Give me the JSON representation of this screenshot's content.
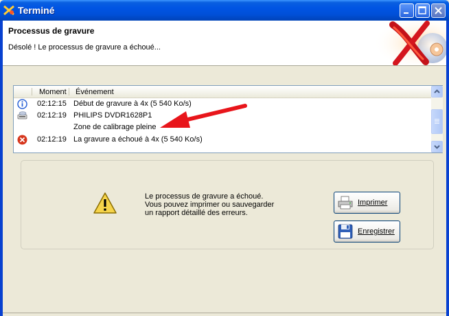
{
  "window": {
    "title": "Terminé"
  },
  "header": {
    "title": "Processus de gravure",
    "subtitle": "Désolé ! Le processus de gravure a échoué..."
  },
  "log": {
    "columns": [
      "Moment",
      "Événement"
    ],
    "rows": [
      {
        "icon": "info-icon",
        "time": "02:12:15",
        "event": "Début de gravure à 4x (5 540 Ko/s)"
      },
      {
        "icon": "drive-icon",
        "time": "02:12:19",
        "event": "PHILIPS  DVDR1628P1"
      },
      {
        "icon": "",
        "time": "",
        "event": "Zone de calibrage pleine"
      },
      {
        "icon": "error-icon",
        "time": "02:12:19",
        "event": "La gravure a échoué à 4x (5 540 Ko/s)"
      }
    ]
  },
  "panel": {
    "message_line1": "Le processus de gravure a échoué.",
    "message_line2": "Vous pouvez imprimer ou sauvegarder",
    "message_line3": "un rapport détaillé des erreurs.",
    "print_label": "Imprimer",
    "save_label": "Enregistrer"
  },
  "colors": {
    "titlebar": "#0054e3",
    "background": "#ece9d8",
    "arrow": "#e8151b",
    "error": "#d6361d"
  }
}
